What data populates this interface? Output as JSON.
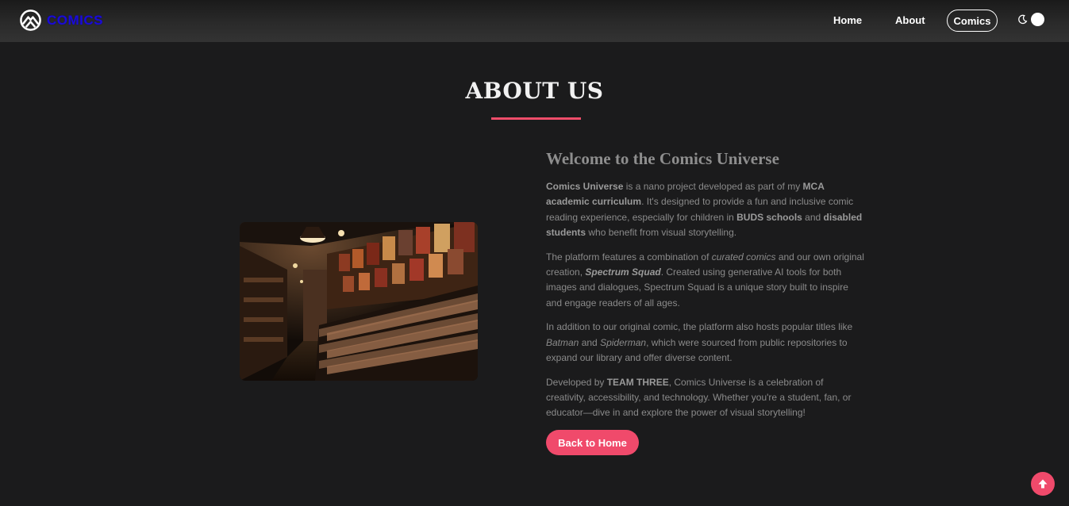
{
  "nav": {
    "brand": "COMICS",
    "links": [
      "Home",
      "About"
    ],
    "active_link": "Comics",
    "theme_toggle_icon": "moon-icon"
  },
  "page": {
    "title": "ABOUT US",
    "image_alt_icon": "comic-store-photo"
  },
  "about": {
    "heading": "Welcome to the Comics Universe",
    "p1": {
      "a": "Comics Universe",
      "b": " is a nano project developed as part of my ",
      "c": "MCA academic curriculum",
      "d": ". It's designed to provide a fun and inclusive comic reading experience, especially for children in ",
      "e": "BUDS schools",
      "f": " and ",
      "g": "disabled students",
      "h": " who benefit from visual storytelling."
    },
    "p2": {
      "a": "The platform features a combination of ",
      "b": "curated comics",
      "c": " and our own original creation, ",
      "d": "Spectrum Squad",
      "e": ". Created using generative AI tools for both images and dialogues, Spectrum Squad is a unique story built to inspire and engage readers of all ages."
    },
    "p3": {
      "a": "In addition to our original comic, the platform also hosts popular titles like ",
      "b": "Batman",
      "c": " and ",
      "d": "Spiderman",
      "e": ", which were sourced from public repositories to expand our library and offer diverse content."
    },
    "p4": {
      "a": "Developed by ",
      "b": "TEAM THREE",
      "c": ", Comics Universe is a celebration of creativity, accessibility, and technology. Whether you're a student, fan, or educator—dive in and explore the power of visual storytelling!"
    },
    "back_button": "Back to Home"
  },
  "colors": {
    "accent": "#f04a6b",
    "brand": "#1b0bd6",
    "background": "#1b1b1c"
  },
  "icons": {
    "logo": "mountain-logo-icon",
    "scroll_top": "arrow-up-icon"
  }
}
